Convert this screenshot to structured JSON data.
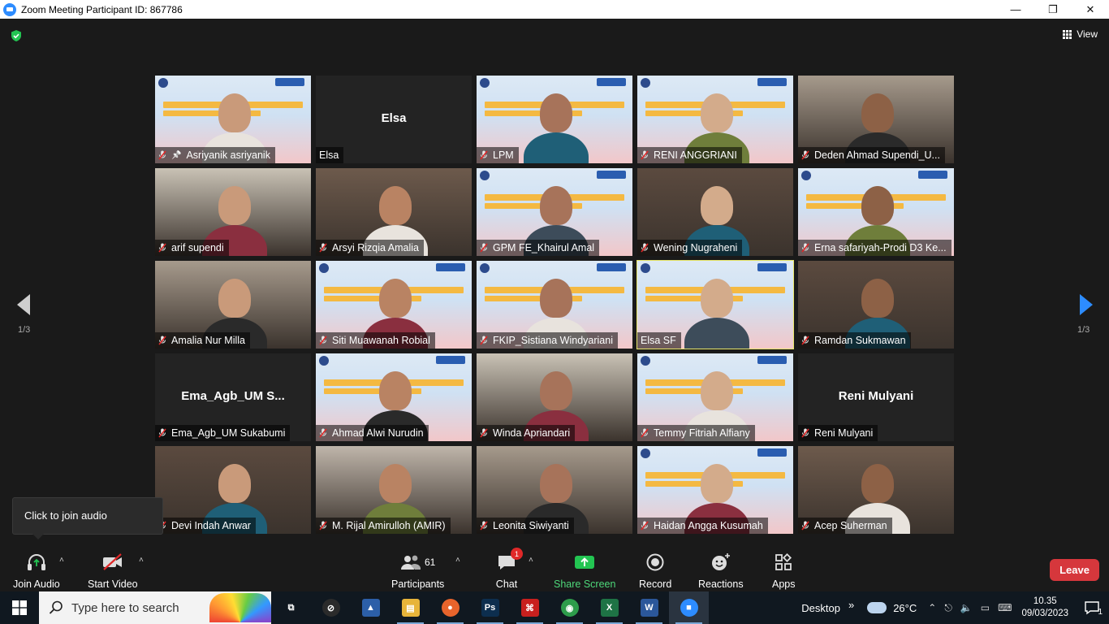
{
  "window": {
    "title": "Zoom Meeting Participant ID: 867786",
    "minimize": "—",
    "restore": "❐",
    "close": "✕"
  },
  "topbar": {
    "view_label": "View"
  },
  "gallery": {
    "page_indicator": "1/3",
    "tiles": [
      {
        "name": "Asriyanik asriyanik",
        "big": "",
        "muted": true,
        "pinned": true,
        "kind": "slide"
      },
      {
        "name": "Elsa",
        "big": "Elsa",
        "muted": false,
        "kind": "blank"
      },
      {
        "name": "LPM",
        "big": "",
        "muted": true,
        "kind": "slide"
      },
      {
        "name": "RENI ANGGRIANI",
        "big": "",
        "muted": true,
        "kind": "slide"
      },
      {
        "name": "Deden Ahmad Supendi_U...",
        "big": "",
        "muted": true,
        "kind": "camera"
      },
      {
        "name": "arif supendi",
        "big": "",
        "muted": true,
        "kind": "camera"
      },
      {
        "name": "Arsyi Rizqia Amalia",
        "big": "",
        "muted": true,
        "kind": "camera"
      },
      {
        "name": "GPM FE_Khairul Amal",
        "big": "",
        "muted": true,
        "kind": "slide"
      },
      {
        "name": "Wening Nugraheni",
        "big": "",
        "muted": true,
        "kind": "camera"
      },
      {
        "name": "Erna safariyah-Prodi D3 Ke...",
        "big": "",
        "muted": true,
        "kind": "slide"
      },
      {
        "name": "Amalia Nur Milla",
        "big": "",
        "muted": true,
        "kind": "camera"
      },
      {
        "name": "Siti Muawanah Robial",
        "big": "",
        "muted": true,
        "kind": "slide"
      },
      {
        "name": "FKIP_Sistiana Windyariani",
        "big": "",
        "muted": true,
        "kind": "slide"
      },
      {
        "name": "Elsa SF",
        "big": "",
        "muted": false,
        "active": true,
        "kind": "slide"
      },
      {
        "name": "Ramdan Sukmawan",
        "big": "",
        "muted": true,
        "kind": "camera"
      },
      {
        "name": "Ema_Agb_UM Sukabumi",
        "big": "Ema_Agb_UM  S...",
        "muted": true,
        "kind": "blank"
      },
      {
        "name": "Ahmad Alwi Nurudin",
        "big": "",
        "muted": true,
        "kind": "slide"
      },
      {
        "name": "Winda Apriandari",
        "big": "",
        "muted": true,
        "kind": "camera"
      },
      {
        "name": "Temmy Fitriah Alfiany",
        "big": "",
        "muted": true,
        "kind": "slide"
      },
      {
        "name": "Reni Mulyani",
        "big": "Reni Mulyani",
        "muted": true,
        "kind": "blank"
      },
      {
        "name": "Devi Indah Anwar",
        "big": "",
        "muted": true,
        "kind": "camera"
      },
      {
        "name": "M. Rijal Amirulloh (AMIR)",
        "big": "",
        "muted": true,
        "kind": "camera"
      },
      {
        "name": "Leonita Siwiyanti",
        "big": "",
        "muted": true,
        "kind": "camera"
      },
      {
        "name": "Haidan Angga Kusumah",
        "big": "",
        "muted": true,
        "kind": "slide"
      },
      {
        "name": "Acep Suherman",
        "big": "",
        "muted": true,
        "kind": "camera"
      }
    ]
  },
  "tooltip": {
    "text": "Click to join audio"
  },
  "toolbar": {
    "join_audio": "Join Audio",
    "start_video": "Start Video",
    "participants": "Participants",
    "participants_count": "61",
    "chat": "Chat",
    "chat_badge": "1",
    "share_screen": "Share Screen",
    "record": "Record",
    "reactions": "Reactions",
    "apps": "Apps",
    "leave": "Leave",
    "caret": "˄"
  },
  "taskbar": {
    "search_placeholder": "Type here to search",
    "desktop_label": "Desktop",
    "chevrons": "»",
    "temperature": "26°C",
    "time": "10.35",
    "date": "09/03/2023",
    "notification_count": "1",
    "apps": [
      {
        "name": "task-view",
        "glyph": "⧉",
        "color": "#101820"
      },
      {
        "name": "app-circle",
        "glyph": "⊘",
        "color": "#2b2b2b"
      },
      {
        "name": "app-inspector",
        "glyph": "▲",
        "color": "#2c5fa8"
      },
      {
        "name": "file-explorer",
        "glyph": "▤",
        "color": "#e7b43a"
      },
      {
        "name": "firefox",
        "glyph": "●",
        "color": "#e8642c"
      },
      {
        "name": "photoshop",
        "glyph": "Ps",
        "color": "#0d2e4e"
      },
      {
        "name": "acrobat",
        "glyph": "⌘",
        "color": "#c8201e"
      },
      {
        "name": "chrome",
        "glyph": "◉",
        "color": "#2e9c4b"
      },
      {
        "name": "excel",
        "glyph": "X",
        "color": "#1e7345"
      },
      {
        "name": "word",
        "glyph": "W",
        "color": "#2b579a"
      },
      {
        "name": "zoom",
        "glyph": "■",
        "color": "#2d8cff"
      }
    ]
  }
}
